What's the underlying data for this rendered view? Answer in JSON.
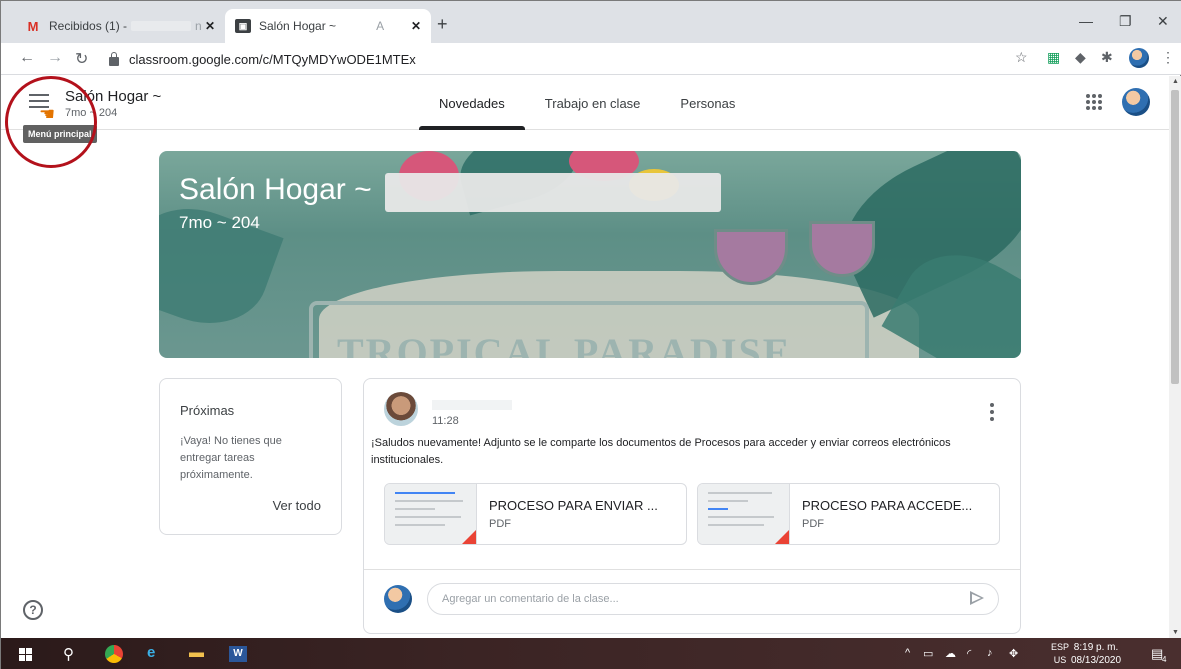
{
  "browser": {
    "tabs": [
      {
        "title": "Recibidos (1) -",
        "favicon": "gmail-icon",
        "tail": "n"
      },
      {
        "title": "Salón Hogar ~",
        "favicon": "classroom-icon",
        "tail": "A"
      }
    ],
    "new_tab": "+",
    "url": "classroom.google.com/c/MTQyMDYwODE1MTEx"
  },
  "header": {
    "class_name": "Salón Hogar ~",
    "section": "7mo ~ 204",
    "tooltip": "Menú principal",
    "tabs": [
      {
        "label": "Novedades",
        "active": true
      },
      {
        "label": "Trabajo en clase",
        "active": false
      },
      {
        "label": "Personas",
        "active": false
      }
    ]
  },
  "banner": {
    "title": "Salón Hogar ~",
    "subtitle": "7mo ~ 204",
    "artwork_text": "TROPICAL PARADISE"
  },
  "upcoming": {
    "title": "Próximas",
    "empty_text": "¡Vaya! No tienes que entregar tareas próximamente.",
    "view_all": "Ver todo"
  },
  "post": {
    "time": "11:28",
    "body": "¡Saludos nuevamente! Adjunto se le comparte los documentos de Procesos para acceder y enviar correos electrónicos institucionales.",
    "attachments": [
      {
        "name": "PROCESO PARA ENVIAR ...",
        "type": "PDF"
      },
      {
        "name": "PROCESO PARA ACCEDE...",
        "type": "PDF"
      }
    ],
    "comment_placeholder": "Agregar un comentario de la clase..."
  },
  "help": "?",
  "taskbar": {
    "lang_top": "ESP",
    "lang_bottom": "US",
    "time": "8:19 p. m.",
    "date": "08/13/2020",
    "notifications": "4"
  },
  "colors": {
    "accent": "#202124",
    "highlight_circle": "#b3111b",
    "pdf_corner": "#ea4335"
  }
}
